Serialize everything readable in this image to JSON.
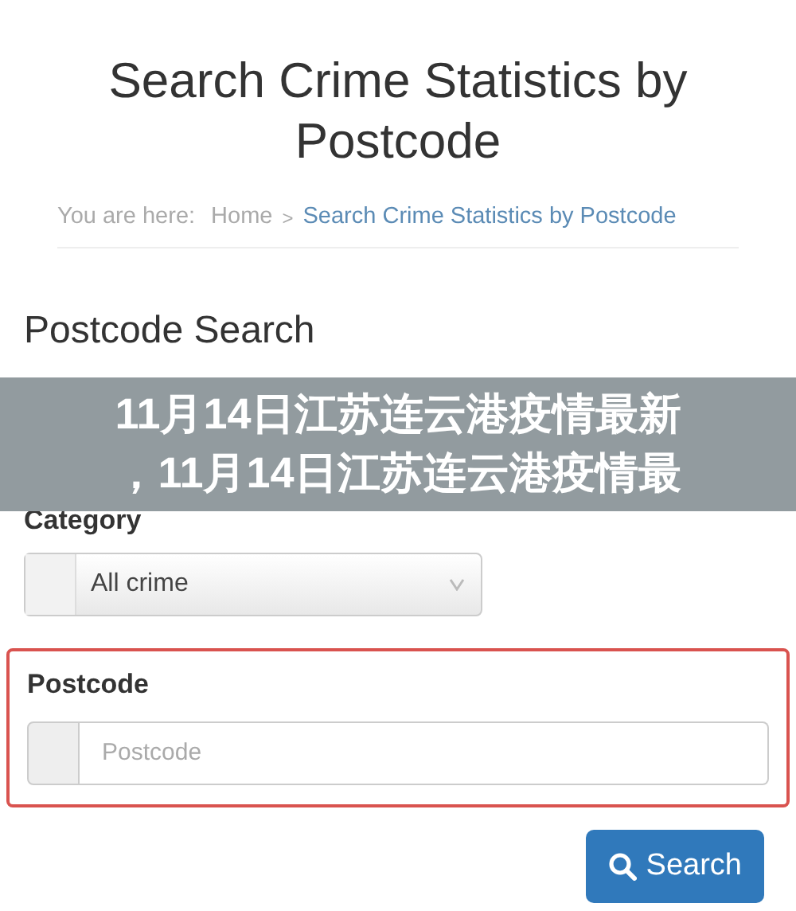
{
  "page": {
    "title": "Search Crime Statistics by Postcode"
  },
  "breadcrumb": {
    "prefix": "You are here:",
    "items": [
      {
        "label": "Home",
        "current": false
      },
      {
        "label": "Search Crime Statistics by Postcode",
        "current": true
      }
    ],
    "separator": ">"
  },
  "form": {
    "heading": "Postcode Search",
    "category": {
      "label": "Category",
      "value": "All crime"
    },
    "postcode": {
      "label": "Postcode",
      "placeholder": "Postcode",
      "error": true
    },
    "submit": "Search"
  },
  "overlay": {
    "lines": [
      "11月14日江苏连云港疫情最新",
      "，11月14日江苏连云港疫情最"
    ]
  }
}
